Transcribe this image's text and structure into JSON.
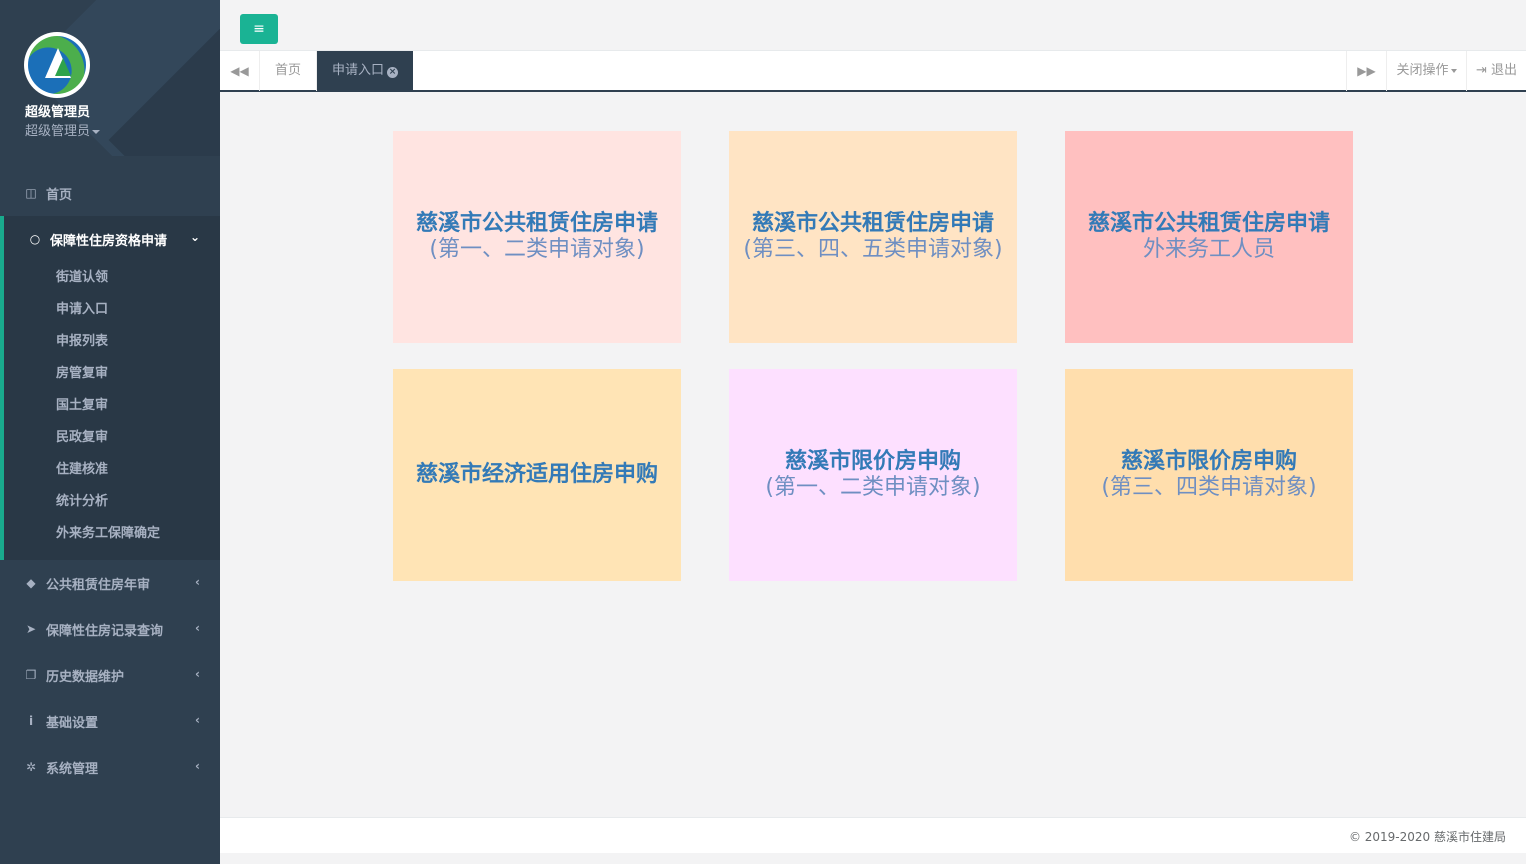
{
  "profile": {
    "name": "超级管理员",
    "role": "超级管理员"
  },
  "sidebar": {
    "home": {
      "label": "首页",
      "icon": "columns-icon"
    },
    "active": {
      "label": "保障性住房资格申请",
      "icon": "comment-icon",
      "items": [
        "街道认领",
        "申请入口",
        "申报列表",
        "房管复审",
        "国土复审",
        "民政复审",
        "住建核准",
        "统计分析",
        "外来务工保障确定"
      ]
    },
    "groups": [
      {
        "label": "公共租赁住房年审",
        "icon": "tag-icon"
      },
      {
        "label": "保障性住房记录查询",
        "icon": "paper-plane-icon"
      },
      {
        "label": "历史数据维护",
        "icon": "copy-icon"
      },
      {
        "label": "基础设置",
        "icon": "info-icon"
      },
      {
        "label": "系统管理",
        "icon": "gear-icon"
      }
    ]
  },
  "tabs": {
    "home": "首页",
    "active": "申请入口",
    "close_ops": "关闭操作",
    "logout": "退出"
  },
  "cards": [
    {
      "title": "慈溪市公共租赁住房申请",
      "subtitle": "(第一、二类申请对象)",
      "color": "#ffe4e1"
    },
    {
      "title": "慈溪市公共租赁住房申请",
      "subtitle": "(第三、四、五类申请对象)",
      "color": "#ffe4c4"
    },
    {
      "title": "慈溪市公共租赁住房申请",
      "subtitle": "外来务工人员",
      "color": "#ffc0c0"
    },
    {
      "title": "慈溪市经济适用住房申购",
      "subtitle": "",
      "color": "#ffe4b5"
    },
    {
      "title": "慈溪市限价房申购",
      "subtitle": "(第一、二类申请对象)",
      "color": "#fde0ff"
    },
    {
      "title": "慈溪市限价房申购",
      "subtitle": "(第三、四类申请对象)",
      "color": "#ffdead"
    }
  ],
  "footer": "© 2019-2020 慈溪市住建局"
}
